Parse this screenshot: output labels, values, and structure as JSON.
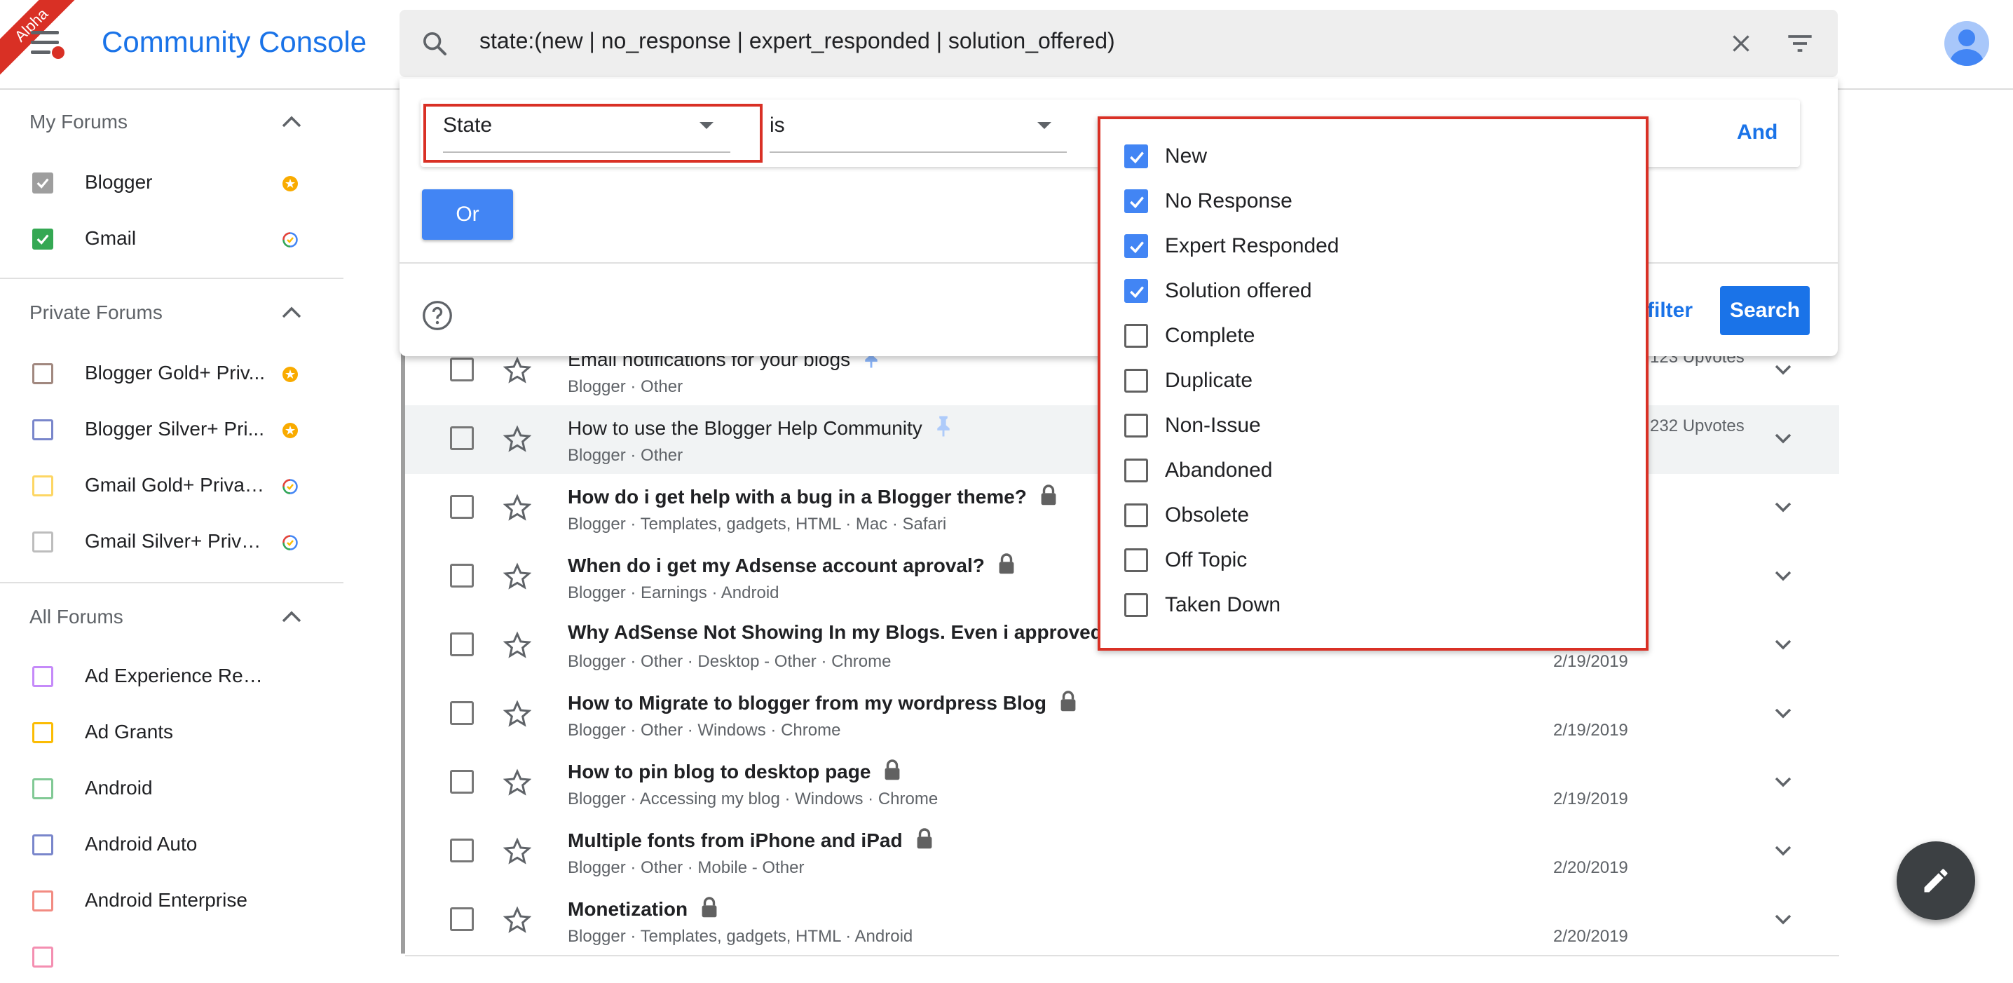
{
  "app": {
    "badge": "Alpha",
    "title": "Community Console"
  },
  "search": {
    "query": "state:(new | no_response | expert_responded | solution_offered)"
  },
  "sidebar": {
    "sections": [
      {
        "title": "My Forums",
        "items": [
          {
            "label": "Blogger",
            "icon": "star-badge-icon",
            "checked": true,
            "style": "grey"
          },
          {
            "label": "Gmail",
            "icon": "google-check-icon",
            "checked": true,
            "style": "green"
          }
        ]
      },
      {
        "title": "Private Forums",
        "items": [
          {
            "label": "Blogger Gold+ Priv...",
            "icon": "star-badge-icon",
            "color": "#a1887f"
          },
          {
            "label": "Blogger Silver+ Pri...",
            "icon": "star-badge-icon",
            "color": "#7986cb"
          },
          {
            "label": "Gmail Gold+ Privat...",
            "icon": "google-check-icon",
            "color": "#fdd663"
          },
          {
            "label": "Gmail Silver+ Priva...",
            "icon": "google-check-icon",
            "color": "#bdbdbd"
          }
        ]
      },
      {
        "title": "All Forums",
        "items": [
          {
            "label": "Ad Experience Rep...",
            "color": "#c58af9"
          },
          {
            "label": "Ad Grants",
            "color": "#fbbc04"
          },
          {
            "label": "Android",
            "color": "#81c995"
          },
          {
            "label": "Android Auto",
            "color": "#7986cb"
          },
          {
            "label": "Android Enterprise",
            "color": "#f28b82"
          }
        ]
      }
    ]
  },
  "filter": {
    "field": "State",
    "operator": "is",
    "and_label": "And",
    "or_label": "Or",
    "clear_filter_label": "filter",
    "search_label": "Search",
    "state_options": [
      {
        "label": "New",
        "checked": true
      },
      {
        "label": "No Response",
        "checked": true
      },
      {
        "label": "Expert Responded",
        "checked": true
      },
      {
        "label": "Solution offered",
        "checked": true
      },
      {
        "label": "Complete",
        "checked": false
      },
      {
        "label": "Duplicate",
        "checked": false
      },
      {
        "label": "Non-Issue",
        "checked": false
      },
      {
        "label": "Abandoned",
        "checked": false
      },
      {
        "label": "Obsolete",
        "checked": false
      },
      {
        "label": "Off Topic",
        "checked": false
      },
      {
        "label": "Taken Down",
        "checked": false
      }
    ]
  },
  "threads": [
    {
      "title": "Email notifications for your blogs",
      "meta": "Blogger · Other",
      "date": "",
      "votes": "123 Upvotes",
      "bold": false,
      "pinned": true
    },
    {
      "title": "How to use the Blogger Help Community",
      "meta": "Blogger · Other",
      "date": "",
      "votes": "232 Upvotes",
      "bold": false,
      "pinned": true,
      "highlight": true
    },
    {
      "title": "How do i get help with a bug in a Blogger theme?",
      "meta": "Blogger · Templates, gadgets, HTML · Mac · Safari",
      "date": "",
      "bold": true,
      "locked": true
    },
    {
      "title": "When do i get my Adsense account aproval?",
      "meta": "Blogger · Earnings · Android",
      "date": "",
      "bold": true,
      "locked": true
    },
    {
      "title": "Why AdSense Not Showing In my Blogs. Even i approved for",
      "meta": "Blogger · Other · Desktop - Other · Chrome",
      "date": "2/19/2019",
      "bold": true
    },
    {
      "title": "How to Migrate to blogger from my wordpress Blog",
      "meta": "Blogger · Other · Windows · Chrome",
      "date": "2/19/2019",
      "bold": true,
      "locked": true
    },
    {
      "title": "How to pin blog to desktop page",
      "meta": "Blogger · Accessing my blog · Windows · Chrome",
      "date": "2/19/2019",
      "bold": true,
      "locked": true
    },
    {
      "title": "Multiple fonts from iPhone and iPad",
      "meta": "Blogger · Other · Mobile - Other",
      "date": "2/20/2019",
      "bold": true,
      "locked": true
    },
    {
      "title": "Monetization",
      "meta": "Blogger · Templates, gadgets, HTML · Android",
      "date": "2/20/2019",
      "bold": true,
      "locked": true
    }
  ]
}
